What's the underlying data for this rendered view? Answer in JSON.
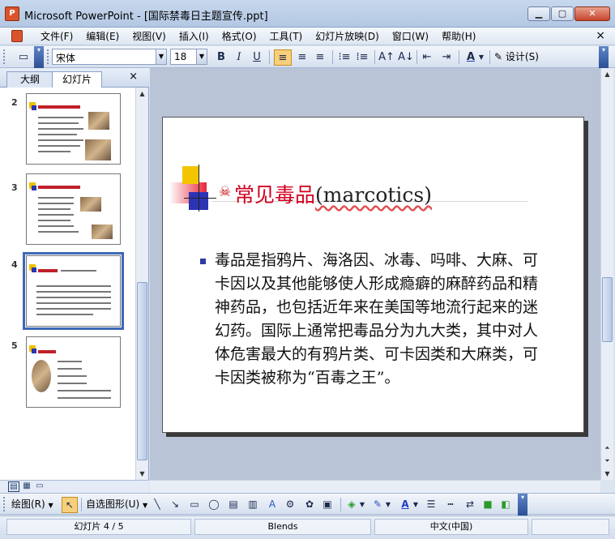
{
  "window": {
    "title": "Microsoft PowerPoint - [国际禁毒日主题宣传.ppt]",
    "app_icon_glyph": "P"
  },
  "menu": {
    "items": [
      "文件(F)",
      "编辑(E)",
      "视图(V)",
      "插入(I)",
      "格式(O)",
      "工具(T)",
      "幻灯片放映(D)",
      "窗口(W)",
      "帮助(H)"
    ],
    "close_glyph": "×"
  },
  "toolbar": {
    "font_name": "宋体",
    "font_size": "18",
    "bold": "B",
    "italic": "I",
    "underline": "U",
    "font_color": "A",
    "design_label": "设计(S)"
  },
  "outline_pane": {
    "tabs": [
      "大纲",
      "幻灯片"
    ],
    "active_tab": "幻灯片",
    "close_glyph": "×",
    "slides": [
      {
        "number": "2"
      },
      {
        "number": "3"
      },
      {
        "number": "4",
        "selected": true
      },
      {
        "number": "5"
      }
    ]
  },
  "slide": {
    "title_cn": "常见毒品",
    "title_en": "(marcotics)",
    "title_icon": "skull-crossbones",
    "body": "毒品是指鸦片、海洛因、冰毒、吗啡、大麻、可卡因以及其他能够使人形成瘾癖的麻醉药品和精神药品，也包括近年来在美国等地流行起来的迷幻药。国际上通常把毒品分为九大类，其中对人体危害最大的有鸦片类、可卡因类和大麻类，可卡因类被称为“百毒之王”。"
  },
  "drawing_toolbar": {
    "draw_label": "绘图(R)",
    "autoshapes_label": "自选图形(U)"
  },
  "status": {
    "slide_position": "幻灯片 4 / 5",
    "design_template": "Blends",
    "language": "中文(中国)"
  },
  "colors": {
    "title_red": "#d1001f",
    "selection_blue": "#3d68b7",
    "bullet_blue": "#2f3aa8"
  }
}
